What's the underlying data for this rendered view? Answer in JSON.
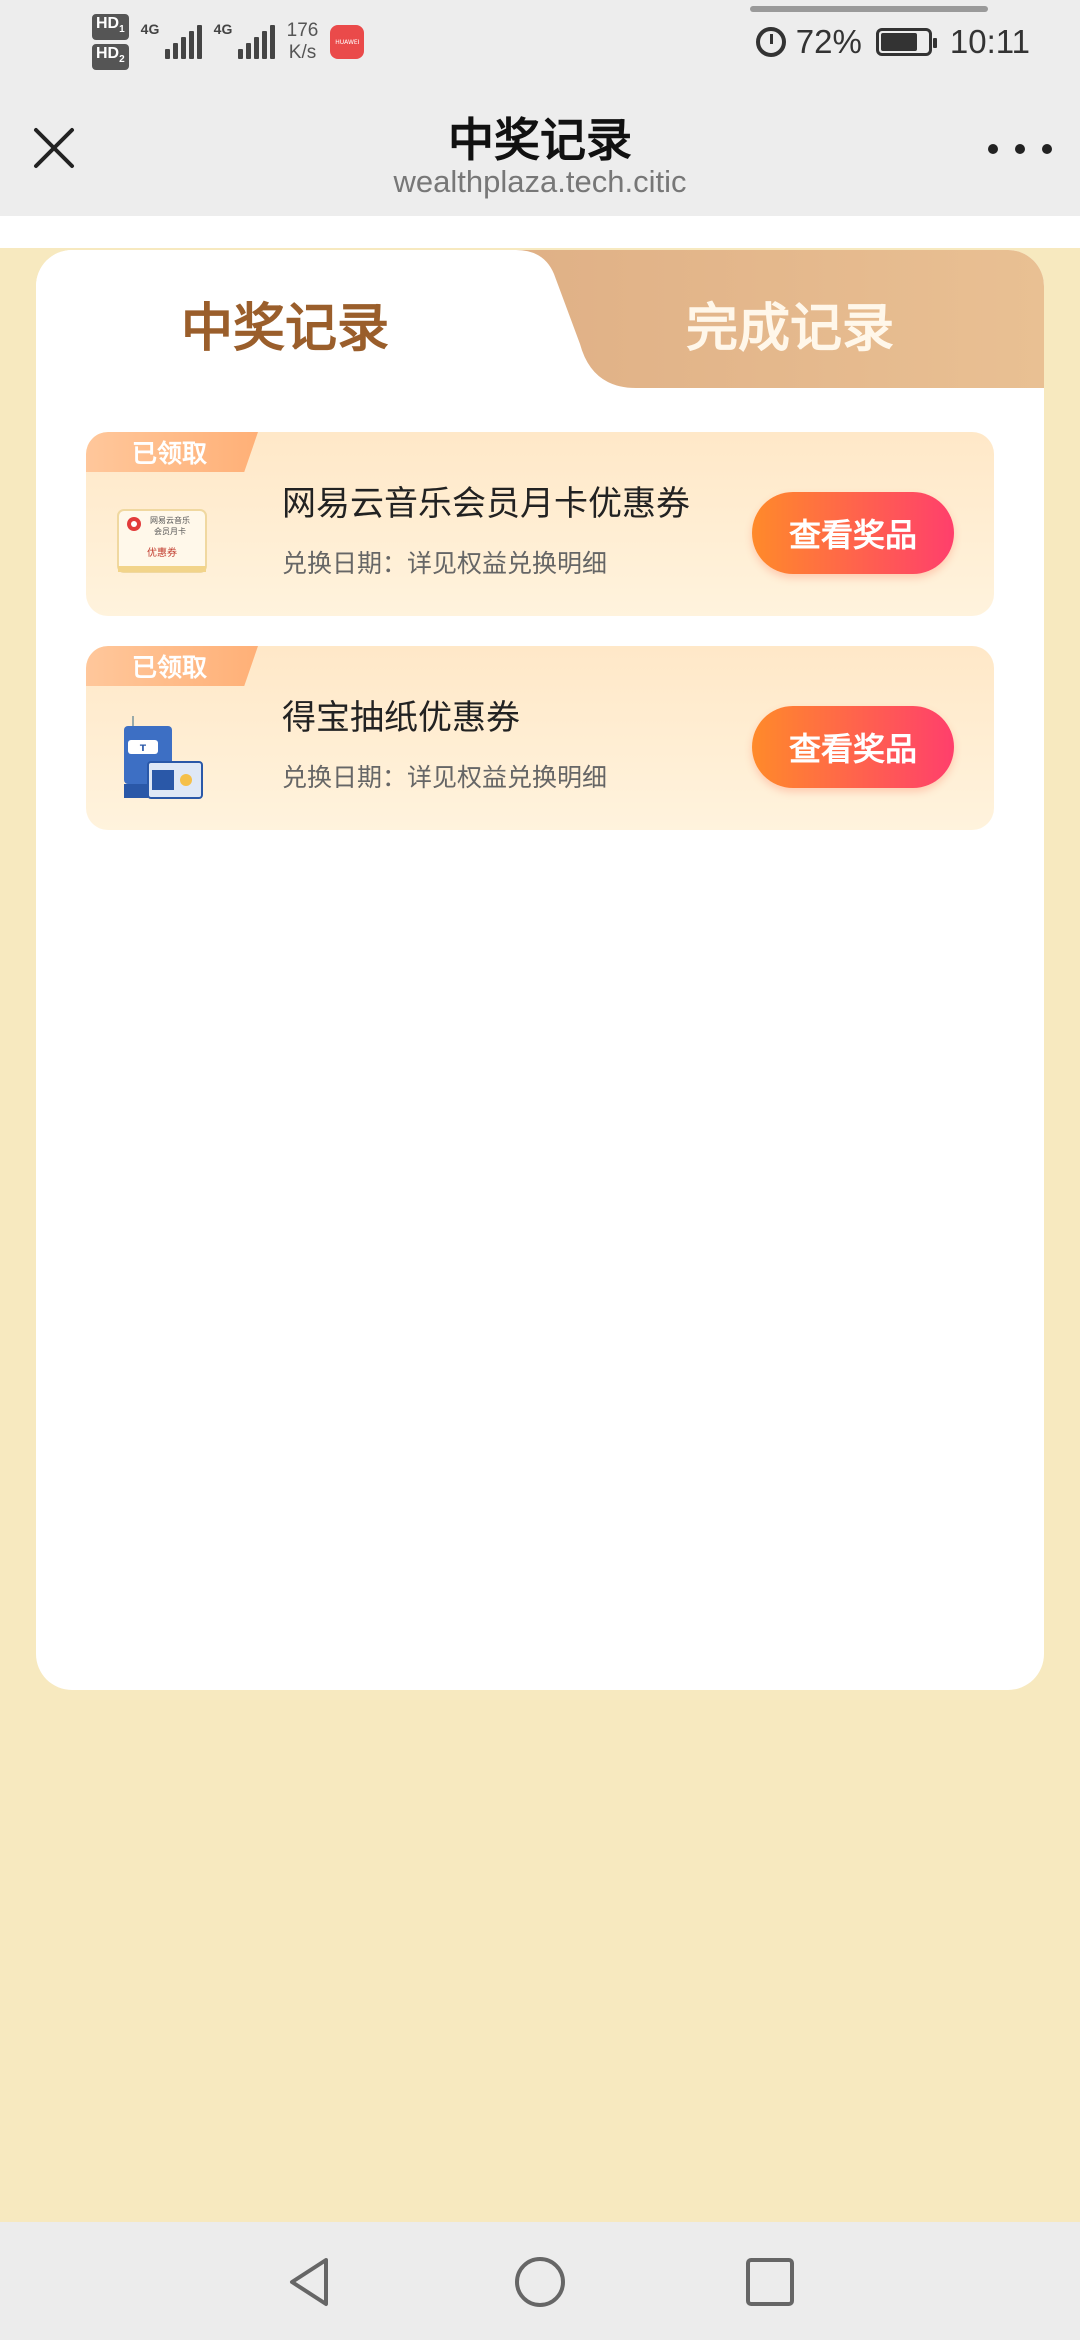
{
  "status_bar": {
    "hd1": "HD",
    "hd1_sub": "1",
    "hd2": "HD",
    "hd2_sub": "2",
    "net1": "4G",
    "net2": "4G",
    "speed_value": "176",
    "speed_unit": "K/s",
    "app_badge": "HUAWEI",
    "battery": "72%",
    "time": "10:11"
  },
  "header": {
    "title": "中奖记录",
    "url": "wealthplaza.tech.citic"
  },
  "tabs": [
    {
      "label": "中奖记录",
      "active": true
    },
    {
      "label": "完成记录",
      "active": false
    }
  ],
  "prizes": [
    {
      "tag": "已领取",
      "name": "网易云音乐会员月卡优惠券",
      "date": "兑换日期：详见权益兑换明细",
      "button": "查看奖品",
      "thumb_icon": "music-coupon-icon",
      "thumb_lines": [
        "网易云音乐",
        "会员月卡",
        "优惠券"
      ]
    },
    {
      "tag": "已领取",
      "name": "得宝抽纸优惠券",
      "date": "兑换日期：详见权益兑换明细",
      "button": "查看奖品",
      "thumb_icon": "tissue-pack-icon",
      "thumb_lines": []
    }
  ],
  "colors": {
    "page_bg": "#f7e9bf",
    "tab_active_text": "#9a5e2b",
    "button_gradient_start": "#ff8a2a",
    "button_gradient_end": "#ff3f6c"
  }
}
